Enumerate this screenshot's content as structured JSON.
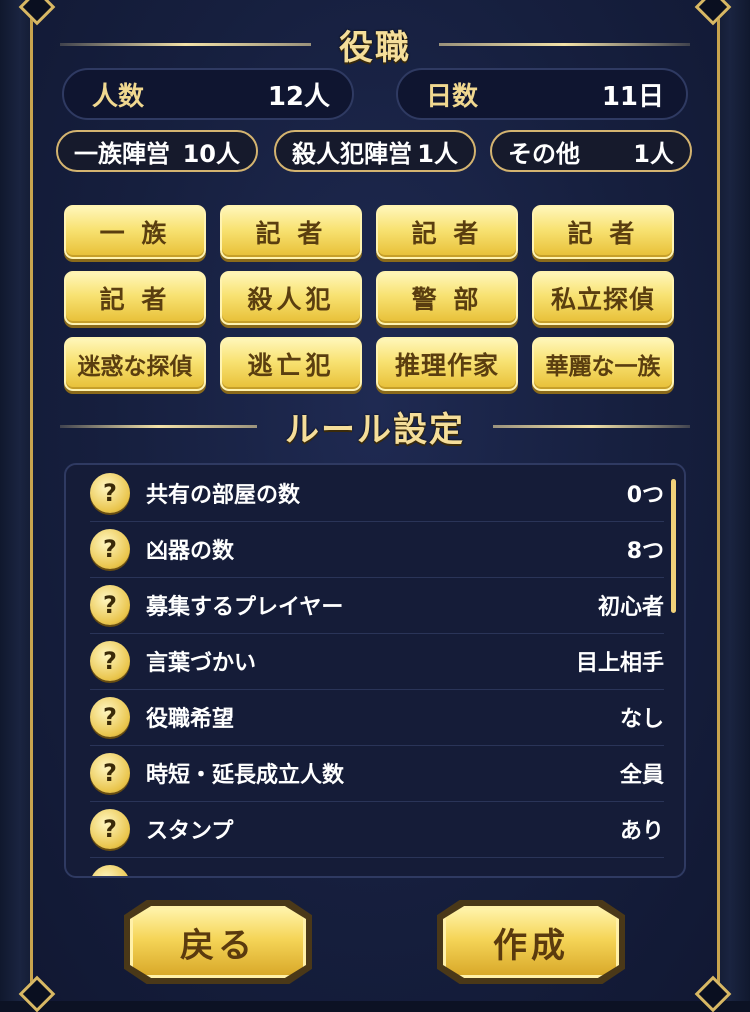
{
  "roles_section": {
    "title": "役職",
    "players": {
      "label": "人数",
      "value": "12人"
    },
    "days": {
      "label": "日数",
      "value": "11日"
    },
    "camps": [
      {
        "label": "一族陣営",
        "value": "10人"
      },
      {
        "label": "殺人犯陣営",
        "value": "1人"
      },
      {
        "label": "その他",
        "value": "1人"
      }
    ],
    "roles": [
      "一 族",
      "記 者",
      "記 者",
      "記 者",
      "記 者",
      "殺人犯",
      "警 部",
      "私立探偵",
      "迷惑な探偵",
      "逃亡犯",
      "推理作家",
      "華麗な一族"
    ]
  },
  "rules_section": {
    "title": "ルール設定",
    "help_glyph": "?",
    "rules": [
      {
        "name": "共有の部屋の数",
        "value": "0つ"
      },
      {
        "name": "凶器の数",
        "value": "8つ"
      },
      {
        "name": "募集するプレイヤー",
        "value": "初心者"
      },
      {
        "name": "言葉づかい",
        "value": "目上相手"
      },
      {
        "name": "役職希望",
        "value": "なし"
      },
      {
        "name": "時短・延長成立人数",
        "value": "全員"
      },
      {
        "name": "スタンプ",
        "value": "あり"
      }
    ]
  },
  "footer": {
    "back_label": "戻る",
    "create_label": "作成"
  },
  "colors": {
    "gold": "#f5de9a",
    "panel": "#161f3e",
    "button": "#f5d558"
  }
}
